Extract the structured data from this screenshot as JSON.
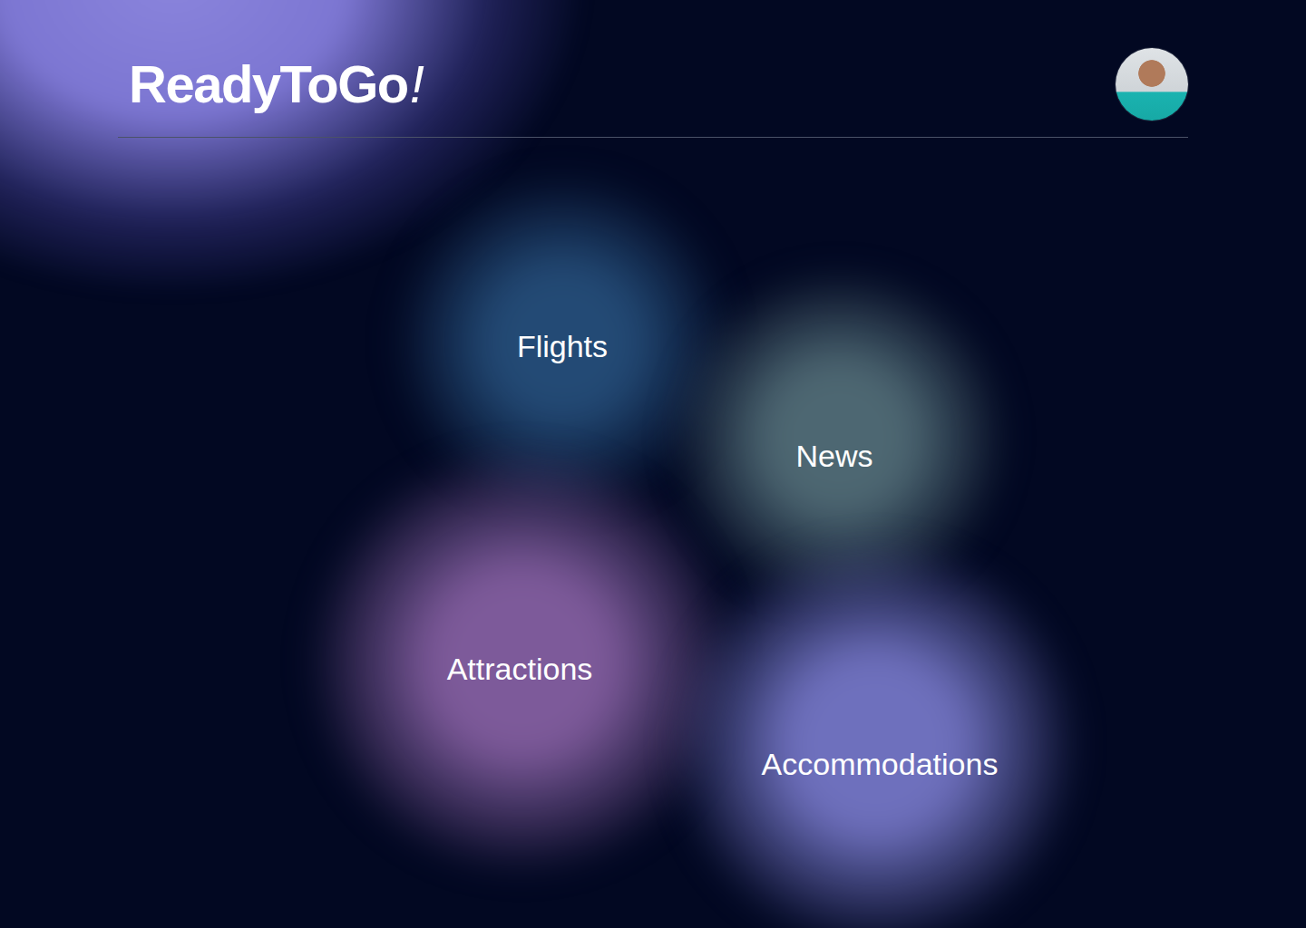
{
  "header": {
    "brand": {
      "name": "ReadyToGo",
      "mark": "!"
    },
    "avatar": {
      "kind": "photo"
    }
  },
  "categories": [
    {
      "label": "Flights",
      "color": "#234a75"
    },
    {
      "label": "News",
      "color": "#4d6772"
    },
    {
      "label": "Attractions",
      "color": "#7d5a9a"
    },
    {
      "label": "Accommodations",
      "color": "#6e70bd"
    }
  ]
}
